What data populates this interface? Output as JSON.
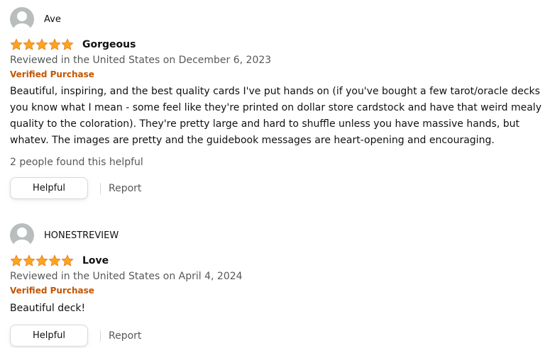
{
  "colors": {
    "star": "#ffa41c",
    "verified": "#c45500",
    "meta_text": "#565959",
    "avatar": "#b8bdbd"
  },
  "reviews": [
    {
      "profile_name": "Ave",
      "avatar_icon": "user-avatar-icon",
      "rating": 5,
      "title": "Gorgeous",
      "date": "Reviewed in the United States on December 6, 2023",
      "badge": "Verified Purchase",
      "body": "Beautiful, inspiring, and the best quality cards I've put hands on (if you've bought a few tarot/oracle decks you know what I mean - some feel like they're printed on dollar store cardstock and have that weird mealy quality to the coloration). They're pretty large and hard to shuffle unless you have massive hands, but whatev. The images are pretty and the guidebook messages are heart-opening and encouraging.",
      "helpful_count": "2 people found this helpful",
      "helpful_label": "Helpful",
      "report_label": "Report"
    },
    {
      "profile_name": "HONESTREVIEW",
      "avatar_icon": "user-avatar-icon",
      "rating": 5,
      "title": "Love",
      "date": "Reviewed in the United States on April 4, 2024",
      "badge": "Verified Purchase",
      "body": "Beautiful deck!",
      "helpful_label": "Helpful",
      "report_label": "Report"
    }
  ]
}
